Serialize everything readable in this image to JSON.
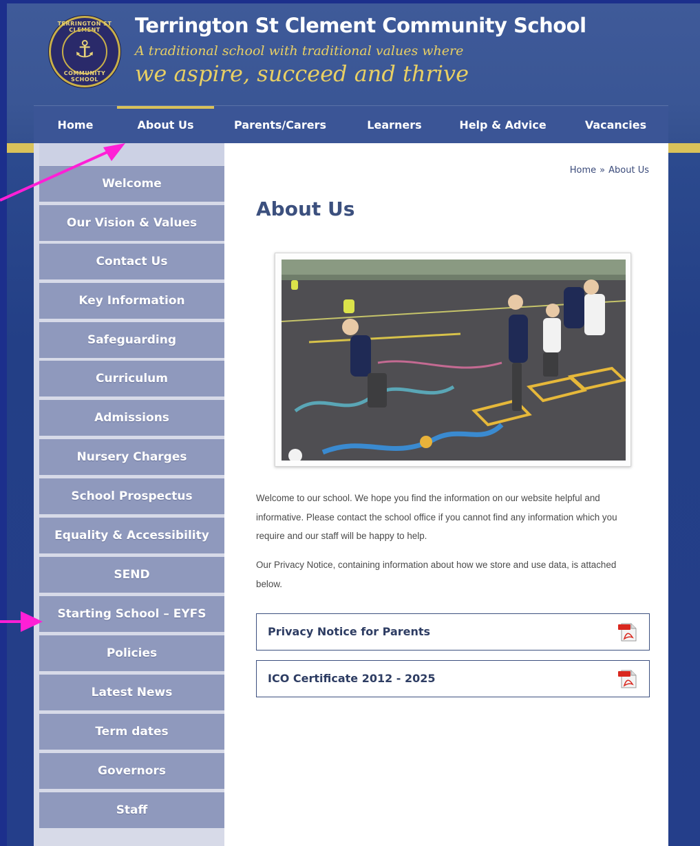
{
  "header": {
    "logo_ring_top": "TERRINGTON ST CLEMENT",
    "logo_ring_bottom": "COMMUNITY SCHOOL",
    "school_name": "Terrington St Clement Community School",
    "tagline_line1": "A traditional school with traditional values where",
    "tagline_line2": "we aspire, succeed and thrive"
  },
  "nav": {
    "items": [
      {
        "label": "Home"
      },
      {
        "label": "About Us",
        "active": true
      },
      {
        "label": "Parents/Carers"
      },
      {
        "label": "Learners"
      },
      {
        "label": "Help & Advice"
      },
      {
        "label": "Vacancies"
      }
    ]
  },
  "sidebar": {
    "items": [
      {
        "label": "Welcome"
      },
      {
        "label": "Our Vision & Values"
      },
      {
        "label": "Contact Us"
      },
      {
        "label": "Key Information"
      },
      {
        "label": "Safeguarding"
      },
      {
        "label": "Curriculum"
      },
      {
        "label": "Admissions"
      },
      {
        "label": "Nursery Charges"
      },
      {
        "label": "School Prospectus"
      },
      {
        "label": "Equality & Accessibility"
      },
      {
        "label": "SEND"
      },
      {
        "label": "Starting School – EYFS"
      },
      {
        "label": "Policies"
      },
      {
        "label": "Latest News"
      },
      {
        "label": "Term dates"
      },
      {
        "label": "Governors"
      },
      {
        "label": "Staff"
      }
    ]
  },
  "breadcrumb": {
    "home": "Home",
    "separator": "»",
    "current": "About Us"
  },
  "main": {
    "title": "About Us",
    "paragraph1_line1": "Welcome to our school.  We hope you find the information on our website helpful and",
    "paragraph1_line2": "informative.  Please contact the school office if you cannot find any information which you",
    "paragraph1_line3": "require and our staff will be happy to help.",
    "paragraph2_line1": "Our Privacy Notice, containing information about how we store and use data, is attached",
    "paragraph2_line2": "below.",
    "documents": [
      {
        "label": "Privacy Notice for Parents",
        "icon": "pdf-icon"
      },
      {
        "label": "ICO Certificate 2012 - 2025",
        "icon": "pdf-icon"
      }
    ]
  },
  "colors": {
    "brand_blue": "#3b5596",
    "gold": "#d9c25a",
    "sidebar_item": "#8f99bd",
    "annotation_arrow": "#ff1fd6"
  }
}
